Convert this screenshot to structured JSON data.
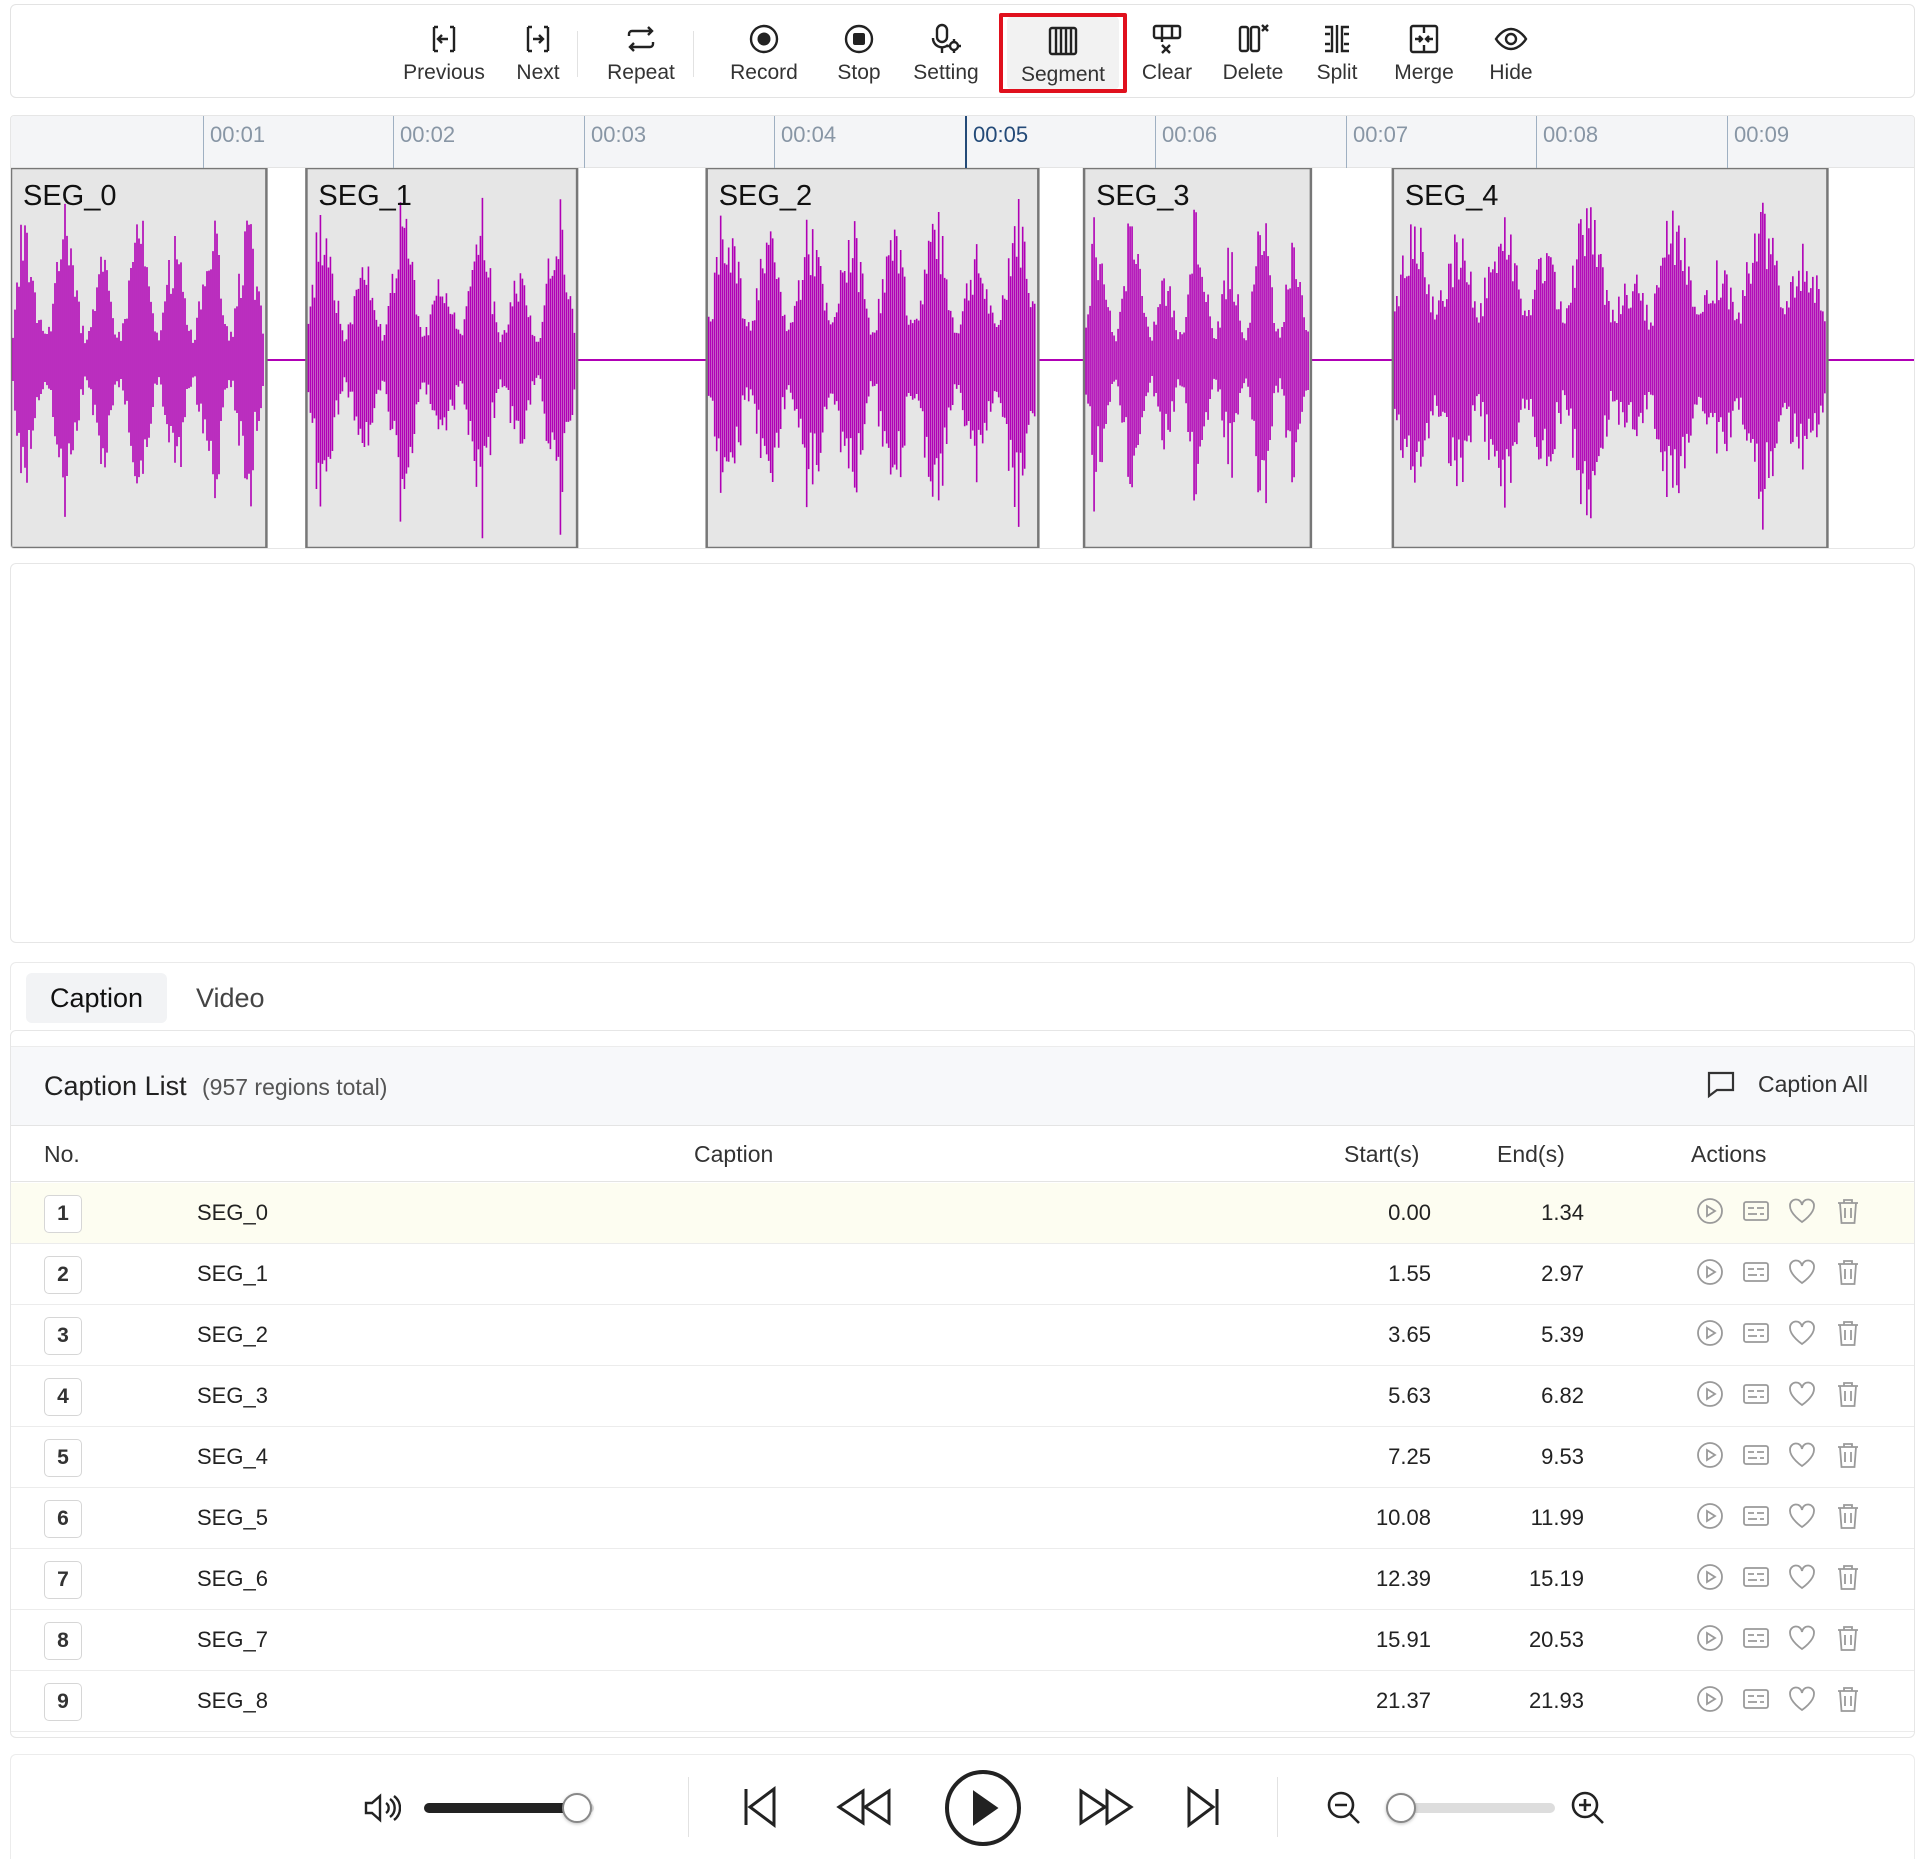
{
  "toolbar": {
    "items": [
      {
        "label": "Previous",
        "icon": "previous-icon"
      },
      {
        "label": "Next",
        "icon": "next-icon"
      },
      {
        "label": "Repeat",
        "icon": "repeat-icon"
      },
      {
        "label": "Record",
        "icon": "record-icon"
      },
      {
        "label": "Stop",
        "icon": "stop-icon"
      },
      {
        "label": "Setting",
        "icon": "mic-settings-icon"
      },
      {
        "label": "Segment",
        "icon": "segment-icon",
        "active": true
      },
      {
        "label": "Clear",
        "icon": "clear-icon"
      },
      {
        "label": "Delete",
        "icon": "delete-region-icon"
      },
      {
        "label": "Split",
        "icon": "split-icon"
      },
      {
        "label": "Merge",
        "icon": "merge-icon"
      },
      {
        "label": "Hide",
        "icon": "eye-icon"
      }
    ],
    "highlight_color": "#e0101d"
  },
  "timeline": {
    "ticks": [
      "00:01",
      "00:02",
      "00:03",
      "00:04",
      "00:05",
      "00:06",
      "00:07",
      "00:08",
      "00:09"
    ],
    "current": "00:05",
    "wave_color": "#b000b5",
    "regions": [
      {
        "label": "SEG_0",
        "start": 0.0,
        "end": 1.34
      },
      {
        "label": "SEG_1",
        "start": 1.55,
        "end": 2.97
      },
      {
        "label": "SEG_2",
        "start": 3.65,
        "end": 5.39
      },
      {
        "label": "SEG_3",
        "start": 5.63,
        "end": 6.82
      },
      {
        "label": "SEG_4",
        "start": 7.25,
        "end": 9.53
      }
    ]
  },
  "tabs": [
    {
      "label": "Caption",
      "active": true
    },
    {
      "label": "Video",
      "active": false
    }
  ],
  "caption_list": {
    "title": "Caption List",
    "count": "(957 regions total)",
    "caption_all": "Caption All",
    "headers": {
      "no": "No.",
      "caption": "Caption",
      "start": "Start(s)",
      "end": "End(s)",
      "actions": "Actions"
    },
    "rows": [
      {
        "no": "1",
        "caption": "SEG_0",
        "start": "0.00",
        "end": "1.34"
      },
      {
        "no": "2",
        "caption": "SEG_1",
        "start": "1.55",
        "end": "2.97"
      },
      {
        "no": "3",
        "caption": "SEG_2",
        "start": "3.65",
        "end": "5.39"
      },
      {
        "no": "4",
        "caption": "SEG_3",
        "start": "5.63",
        "end": "6.82"
      },
      {
        "no": "5",
        "caption": "SEG_4",
        "start": "7.25",
        "end": "9.53"
      },
      {
        "no": "6",
        "caption": "SEG_5",
        "start": "10.08",
        "end": "11.99"
      },
      {
        "no": "7",
        "caption": "SEG_6",
        "start": "12.39",
        "end": "15.19"
      },
      {
        "no": "8",
        "caption": "SEG_7",
        "start": "15.91",
        "end": "20.53"
      },
      {
        "no": "9",
        "caption": "SEG_8",
        "start": "21.37",
        "end": "21.93"
      }
    ],
    "row_actions": [
      "play-icon",
      "subtitle-icon",
      "heart-icon",
      "trash-icon"
    ]
  },
  "player": {
    "volume": 0.9,
    "zoom": 0.0,
    "controls": [
      "volume-icon",
      "skip-start-icon",
      "rewind-icon",
      "play-icon",
      "fast-forward-icon",
      "skip-end-icon",
      "zoom-out-icon",
      "zoom-in-icon"
    ]
  }
}
